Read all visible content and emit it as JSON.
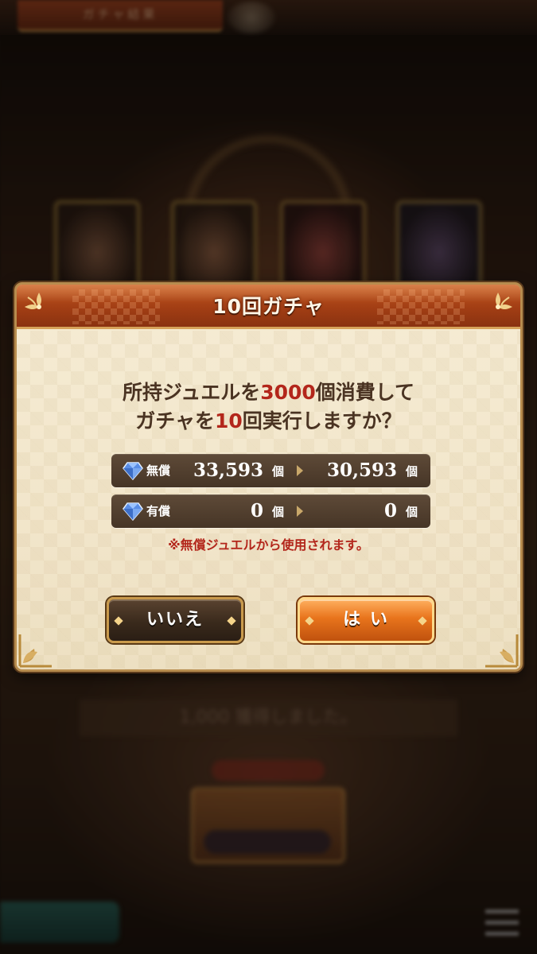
{
  "background": {
    "tab_label": "ガチャ結果",
    "notice_text": "1,000 獲得しました。"
  },
  "dialog": {
    "title": "10回ガチャ",
    "message": {
      "line1_pre": "所持ジュエルを",
      "line1_amount": "3000",
      "line1_post": "個消費して",
      "line2_pre": "ガチャを",
      "line2_count": "10",
      "line2_post": "回実行しますか？"
    },
    "free_jewels": {
      "label": "無償",
      "before": "33,593",
      "after": "30,593",
      "unit": "個"
    },
    "paid_jewels": {
      "label": "有償",
      "before": "0",
      "after": "0",
      "unit": "個"
    },
    "note": "※無償ジュエルから使用されます。",
    "no_label": "いいえ",
    "yes_label": "は い"
  },
  "colors": {
    "highlight": "#b3261b",
    "header": "#a23e14",
    "panel": "#f4e9d0"
  }
}
